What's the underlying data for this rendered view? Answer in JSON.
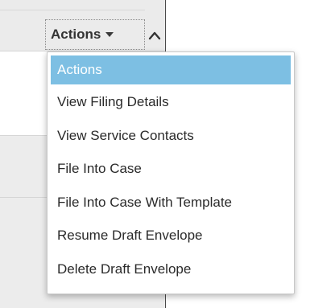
{
  "trigger": {
    "label": "Actions",
    "caret_icon": "caret-down-icon",
    "collapse_icon": "chevron-up-icon"
  },
  "menu": {
    "items": [
      {
        "label": "Actions",
        "selected": true
      },
      {
        "label": "View Filing Details",
        "selected": false
      },
      {
        "label": "View Service Contacts",
        "selected": false
      },
      {
        "label": "File Into Case",
        "selected": false
      },
      {
        "label": "File Into Case With Template",
        "selected": false
      },
      {
        "label": "Resume Draft Envelope",
        "selected": false
      },
      {
        "label": "Delete Draft Envelope",
        "selected": false
      }
    ]
  },
  "colors": {
    "selected_bg": "#7dbfe3",
    "selected_text": "#ffffff",
    "row_gray": "#ececec",
    "text": "#2a2a2a"
  }
}
